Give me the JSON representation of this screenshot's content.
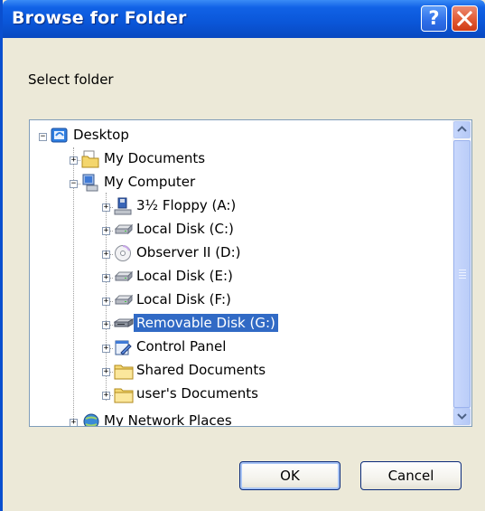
{
  "window": {
    "title": "Browse for Folder",
    "help_label": "?",
    "close_label": "✕"
  },
  "prompt": "Select folder",
  "tree": {
    "items": [
      {
        "label": "Desktop",
        "icon": "desktop-icon",
        "expanded": true
      },
      {
        "label": "My Documents",
        "icon": "folder-documents-icon",
        "expanded": false
      },
      {
        "label": "My Computer",
        "icon": "computer-icon",
        "expanded": true
      },
      {
        "label": "3½ Floppy (A:)",
        "icon": "floppy-drive-icon",
        "expanded": false
      },
      {
        "label": "Local Disk (C:)",
        "icon": "hard-drive-icon",
        "expanded": false
      },
      {
        "label": "Observer II (D:)",
        "icon": "cd-drive-icon",
        "expanded": false
      },
      {
        "label": "Local Disk (E:)",
        "icon": "hard-drive-icon",
        "expanded": false
      },
      {
        "label": "Local Disk (F:)",
        "icon": "hard-drive-icon",
        "expanded": false
      },
      {
        "label": "Removable Disk (G:)",
        "icon": "removable-drive-icon",
        "expanded": false,
        "selected": true
      },
      {
        "label": "Control Panel",
        "icon": "control-panel-icon",
        "expanded": false
      },
      {
        "label": "Shared Documents",
        "icon": "folder-icon",
        "expanded": false
      },
      {
        "label": "user's Documents",
        "icon": "folder-icon",
        "expanded": false
      },
      {
        "label": "My Network Places",
        "icon": "network-places-icon",
        "expanded": false
      }
    ]
  },
  "buttons": {
    "ok": "OK",
    "cancel": "Cancel"
  },
  "colors": {
    "titlebar": "#0a56d8",
    "selection": "#316ac5",
    "dialog_bg": "#ece9d8"
  }
}
